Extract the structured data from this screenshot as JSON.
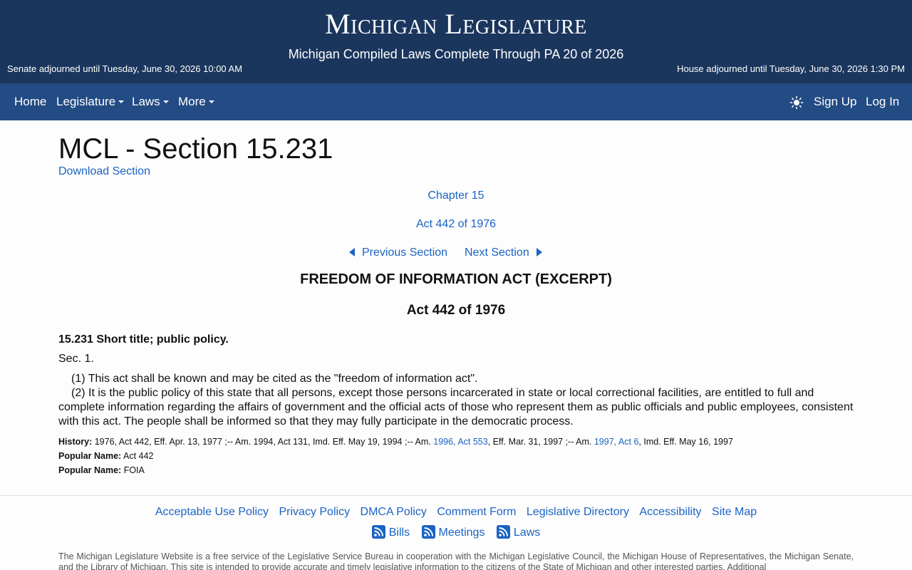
{
  "banner": {
    "title": "Michigan Legislature",
    "subtitle": "Michigan Compiled Laws Complete Through PA 20 of 2026",
    "senate_status": "Senate adjourned until Tuesday, June 30, 2026 10:00 AM",
    "house_status": "House adjourned until Tuesday, June 30, 2026 1:30 PM"
  },
  "nav": {
    "home": "Home",
    "legislature": "Legislature",
    "laws": "Laws",
    "more": "More",
    "theme_icon": "sun-icon",
    "sign_up": "Sign Up",
    "log_in": "Log In"
  },
  "page": {
    "heading": "MCL - Section 15.231",
    "download": "Download Section",
    "chapter": "Chapter 15",
    "act_link": "Act 442 of 1976",
    "previous": "Previous Section",
    "next": "Next Section",
    "act_title": "FREEDOM OF INFORMATION ACT (EXCERPT)",
    "act_number": "Act 442 of 1976",
    "section_title": "15.231 Short title; public policy.",
    "section_no": "Sec. 1.",
    "paragraph1": "(1) This act shall be known and may be cited as the \"freedom of information act\".",
    "paragraph2": "(2) It is the public policy of this state that all persons, except those persons incarcerated in state or local correctional facilities, are entitled to full and complete information regarding the affairs of government and the official acts of those who represent them as public officials and public employees, consistent with this act. The people shall be informed so that they may fully participate in the democratic process."
  },
  "history": {
    "label": "History:",
    "text_a": "1976, Act 442, Eff. Apr. 13, 1977 ;-- Am. 1994, Act 131, Imd. Eff. May 19, 1994 ;-- Am.",
    "link_1": "1996, Act 553",
    "text_b": ", Eff. Mar. 31, 1997 ;-- Am.",
    "link_2": "1997, Act 6",
    "text_c": ", Imd. Eff. May 16, 1997"
  },
  "popular_names": [
    {
      "label": "Popular Name:",
      "value": "Act 442"
    },
    {
      "label": "Popular Name:",
      "value": "FOIA"
    }
  ],
  "footer": {
    "links": [
      "Acceptable Use Policy",
      "Privacy Policy",
      "DMCA Policy",
      "Comment Form",
      "Legislative Directory",
      "Accessibility",
      "Site Map"
    ],
    "feeds": [
      "Bills",
      "Meetings",
      "Laws"
    ],
    "feed_icon": "rss-icon",
    "disclaimer": "The Michigan Legislature Website is a free service of the Legislative Service Bureau in cooperation with the Michigan Legislative Council, the Michigan House of Representatives, the Michigan Senate, and the Library of Michigan. This site is intended to provide accurate and timely legislative information to the citizens of the State of Michigan and other interested parties. Additional"
  },
  "colors": {
    "banner": "#1b365d",
    "nav": "#234b84",
    "link": "#1a63c4"
  }
}
